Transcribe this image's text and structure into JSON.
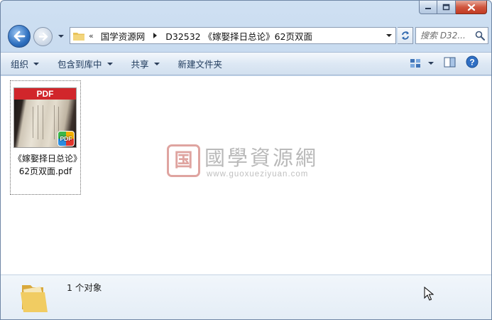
{
  "window": {
    "caption_buttons": [
      "minimize",
      "maximize",
      "close"
    ]
  },
  "address": {
    "overflow_chevron": "«",
    "crumbs": [
      "国学资源网",
      "D32532 《嫁娶择日总论》62页双面"
    ]
  },
  "search": {
    "placeholder": "搜索 D32..."
  },
  "toolbar": {
    "organize": "组织",
    "include_in_library": "包含到库中",
    "share": "共享",
    "new_folder": "新建文件夹"
  },
  "file": {
    "thumb_label": "PDF",
    "badge_label": "PDF",
    "name": "《嫁娶择日总论》62页双面.pdf"
  },
  "watermark": {
    "seal": "国",
    "title": "國學資源網",
    "url": "www.guoxueziyuan.com"
  },
  "details": {
    "count_text": "1 个对象"
  },
  "colors": {
    "accent": "#2d6fbf",
    "toolbar_text": "#1e395b",
    "pdf_red": "#d1262b"
  }
}
